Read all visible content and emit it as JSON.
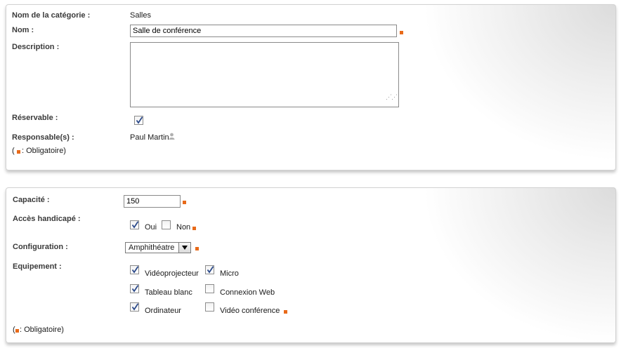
{
  "section1": {
    "category_label": "Nom de la catégorie :",
    "category_value": "Salles",
    "name_label": "Nom :",
    "name_value": "Salle de conférence",
    "description_label": "Description :",
    "description_value": "",
    "reservable_label": "Réservable :",
    "reservable_checked": true,
    "managers_label": "Responsable(s) :",
    "managers_value": "Paul Martin",
    "legend_open": "(",
    "legend_text": ": Obligatoire)"
  },
  "section2": {
    "capacity_label": "Capacité :",
    "capacity_value": "150",
    "access_label": "Accès handicapé :",
    "access_options": [
      {
        "label": "Oui",
        "checked": true
      },
      {
        "label": "Non",
        "checked": false
      }
    ],
    "config_label": "Configuration :",
    "config_value": "Amphithéatre",
    "equipment_label": "Equipement :",
    "equipment_items": [
      {
        "label": "Vidéoprojecteur",
        "checked": true
      },
      {
        "label": "Micro",
        "checked": true
      },
      {
        "label": "Tableau blanc",
        "checked": true
      },
      {
        "label": "Connexion Web",
        "checked": false
      },
      {
        "label": "Ordinateur",
        "checked": true
      },
      {
        "label": "Vidéo conférence",
        "checked": false
      }
    ],
    "legend_open": "(",
    "legend_text": ": Obligatoire)"
  },
  "colors": {
    "required_marker": "#e86a1a",
    "check": "#2c4a8a",
    "label": "#3a3a3a"
  }
}
